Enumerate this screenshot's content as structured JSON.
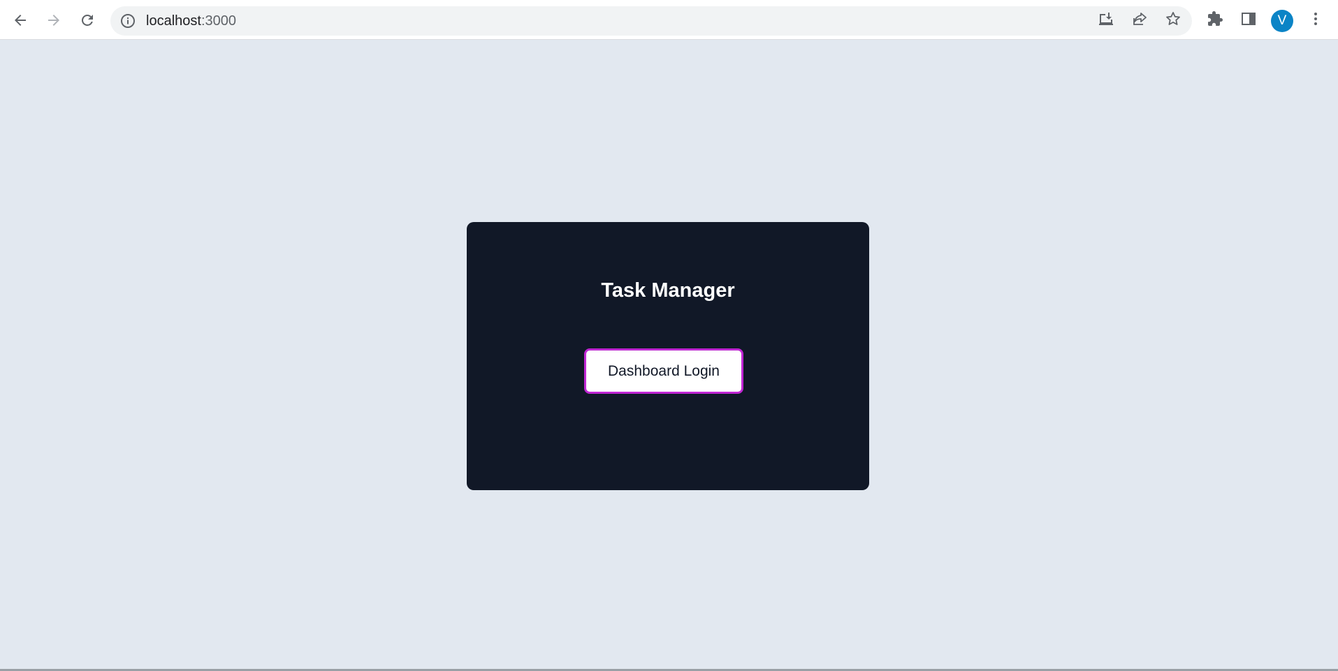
{
  "browser": {
    "url_host": "localhost",
    "url_port": ":3000",
    "profile_initial": "V",
    "icons": {
      "back": "arrow-left-icon",
      "forward": "arrow-right-icon",
      "reload": "reload-icon",
      "site_info": "info-icon",
      "install": "install-app-icon",
      "share": "share-icon",
      "bookmark": "star-icon",
      "extensions": "puzzle-icon",
      "side_panel": "side-panel-icon",
      "menu": "kebab-menu-icon"
    }
  },
  "page": {
    "title": "Task Manager",
    "login_button_label": "Dashboard Login",
    "colors": {
      "background": "#e2e8f0",
      "card": "#111827",
      "button_border": "#c026d3",
      "avatar": "#0b84c6"
    }
  }
}
